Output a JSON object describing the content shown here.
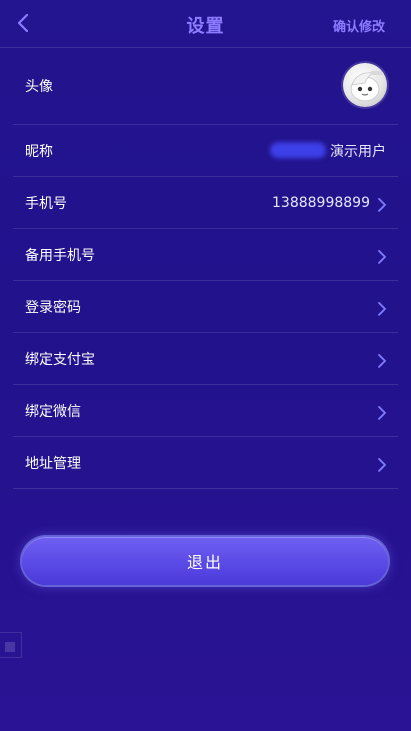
{
  "header": {
    "title": "设置",
    "confirm_label": "确认修改",
    "back_icon": "chevron-left-icon",
    "accent_color": "#8c7cff"
  },
  "settings": {
    "avatar_label": "头像",
    "nickname_label": "昵称",
    "nickname_value": "演示用户",
    "phone_label": "手机号",
    "phone_value": "13888998899",
    "backup_phone_label": "备用手机号",
    "login_password_label": "登录密码",
    "bind_alipay_label": "绑定支付宝",
    "bind_wechat_label": "绑定微信",
    "address_label": "地址管理"
  },
  "logout": {
    "label": "退出"
  },
  "colors": {
    "background": "#23148f",
    "button": "#5a4ae6",
    "chevron": "#7f7cff"
  }
}
